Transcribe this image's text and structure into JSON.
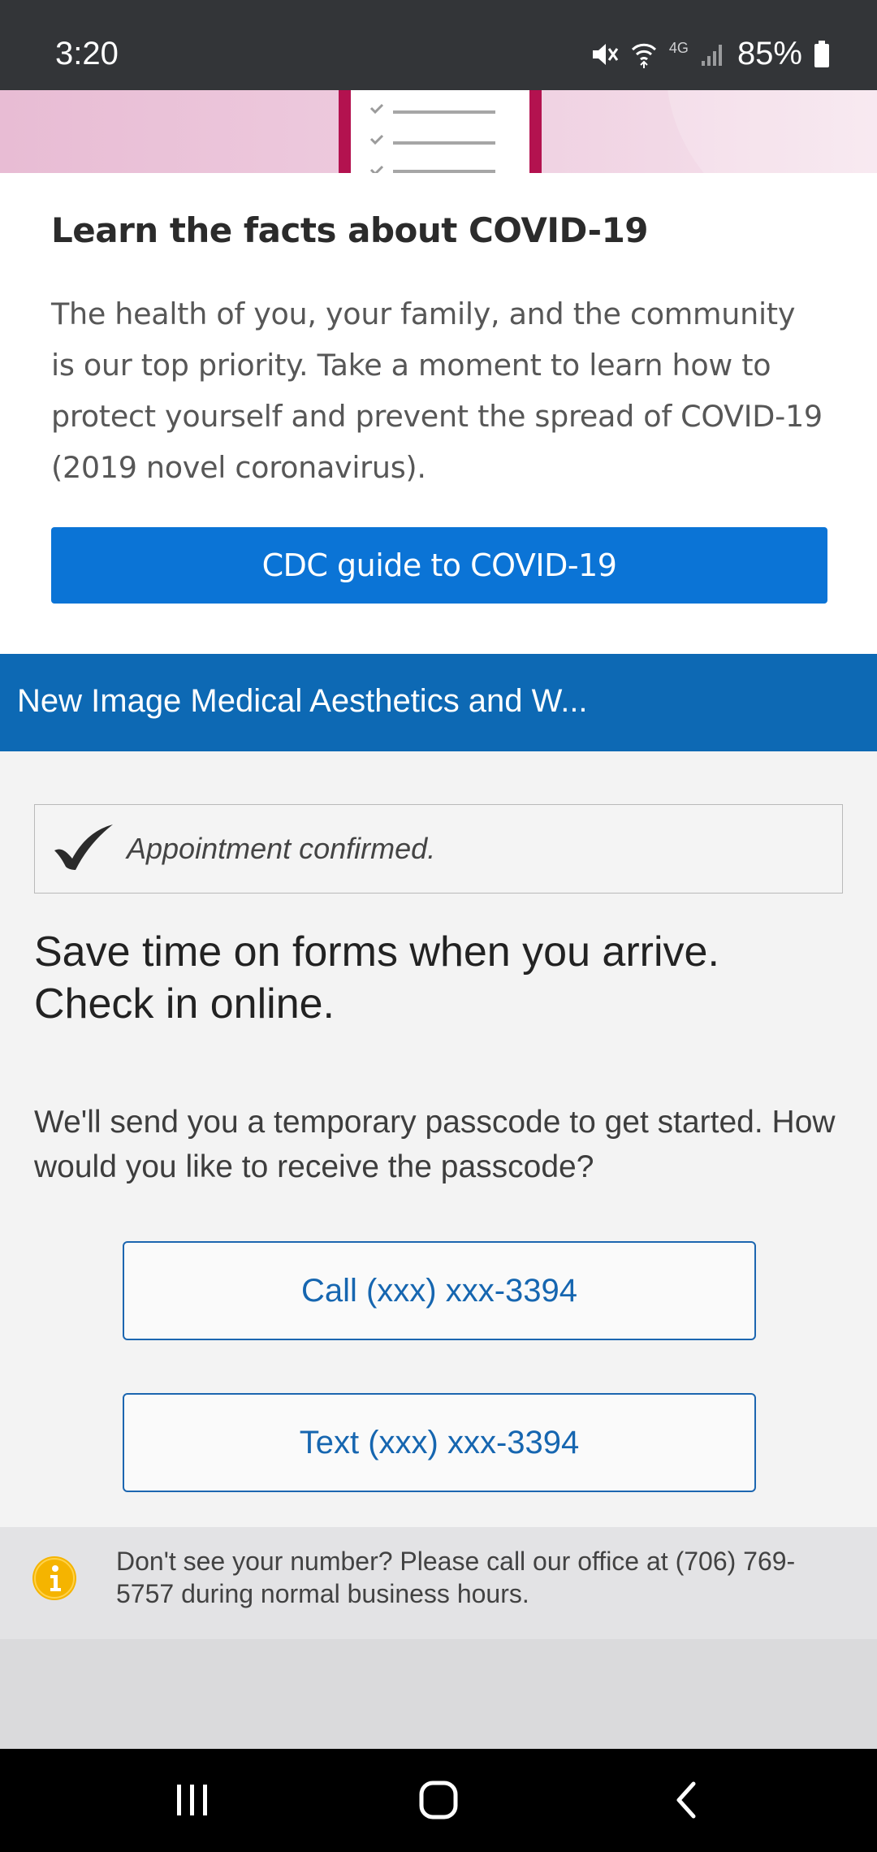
{
  "status_bar": {
    "time": "3:20",
    "network_label": "4G",
    "battery": "85%",
    "icons": [
      "mute-icon",
      "wifi-icon",
      "signal-icon",
      "battery-icon"
    ]
  },
  "covid_card": {
    "title": "Learn the facts about COVID-19",
    "body": "The health of you, your family, and the community is our top priority. Take a moment to learn how to protect yourself and prevent the spread of COVID-19 (2019 novel coronavirus).",
    "button_label": "CDC guide to COVID-19",
    "button_color": "#0b74d6"
  },
  "practice": {
    "name": "New Image Medical Aesthetics and W...",
    "header_color": "#0d69b4"
  },
  "confirmation": {
    "text": "Appointment confirmed."
  },
  "checkin": {
    "headline": "Save time on forms when you arrive. Check in online.",
    "instruction": "We'll send you a temporary passcode to get started. How would you like to receive the passcode?",
    "call_label": "Call (xxx) xxx-3394",
    "text_label": "Text (xxx) xxx-3394"
  },
  "info": {
    "text": "Don't see your number? Please call our office at (706) 769-5757 during normal business hours.",
    "icon_color": "#f5b400"
  },
  "nav_bar": {
    "items": [
      "recents-icon",
      "home-icon",
      "back-icon"
    ]
  }
}
